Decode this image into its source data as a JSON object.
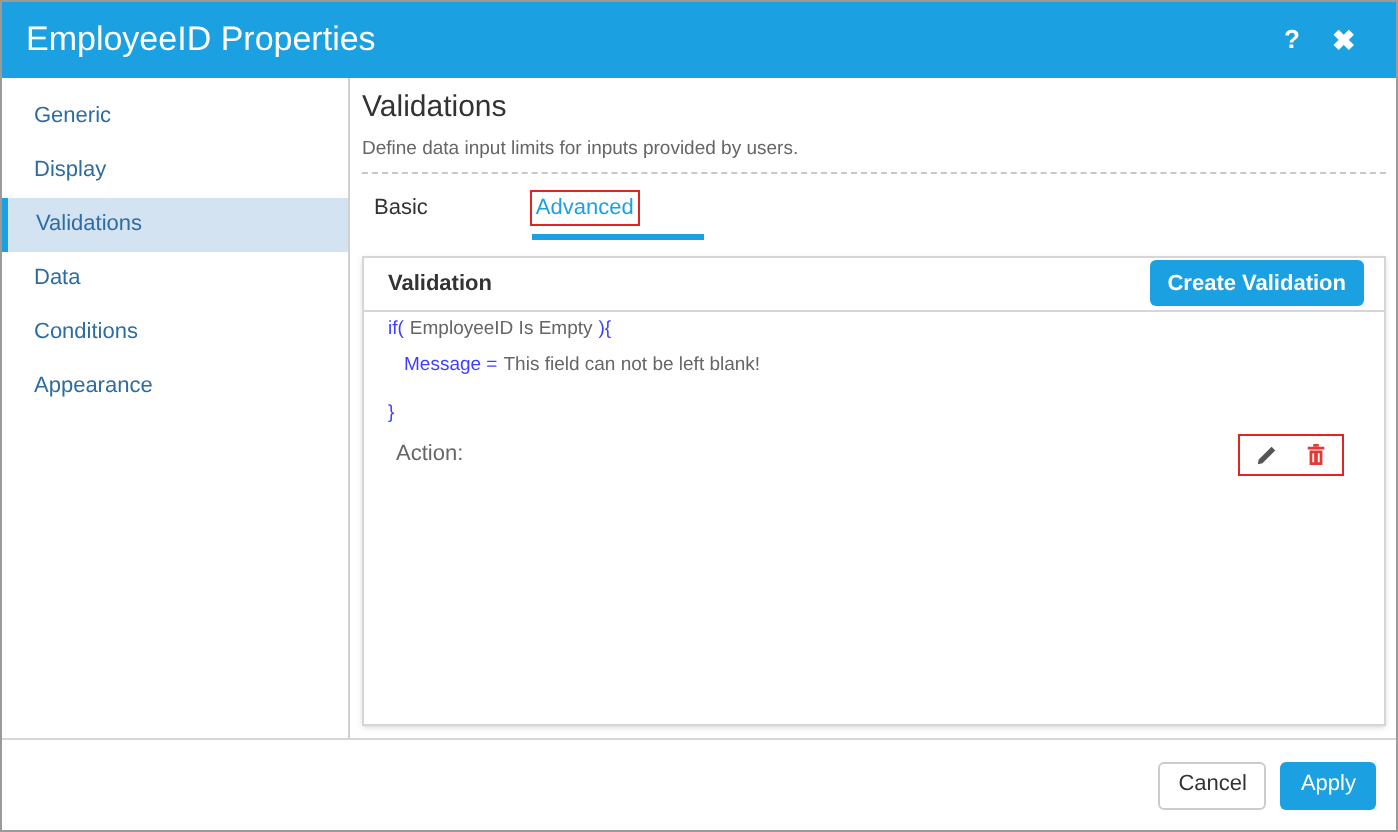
{
  "window": {
    "title": "EmployeeID Properties",
    "help": "?",
    "close": "✖"
  },
  "sidebar": {
    "items": [
      {
        "label": "Generic",
        "selected": false
      },
      {
        "label": "Display",
        "selected": false
      },
      {
        "label": "Validations",
        "selected": true
      },
      {
        "label": "Data",
        "selected": false
      },
      {
        "label": "Conditions",
        "selected": false
      },
      {
        "label": "Appearance",
        "selected": false
      }
    ]
  },
  "section": {
    "title": "Validations",
    "description": "Define data input limits for inputs provided by users."
  },
  "tabs": [
    {
      "label": "Basic",
      "selected": false,
      "highlighted": false
    },
    {
      "label": "Advanced",
      "selected": true,
      "highlighted": true
    }
  ],
  "validation": {
    "heading": "Validation",
    "create_button": "Create Validation",
    "condition": {
      "open": "if(",
      "text": "EmployeeID Is Empty",
      "close": "){"
    },
    "message": {
      "key": "Message =",
      "value": "This field can not be left blank!"
    },
    "end": "}",
    "action_label": "Action:",
    "actions_highlighted": true
  },
  "footer": {
    "buttons": [
      {
        "label": "Cancel",
        "kind": "secondary"
      },
      {
        "label": "Apply",
        "kind": "primary"
      }
    ]
  }
}
